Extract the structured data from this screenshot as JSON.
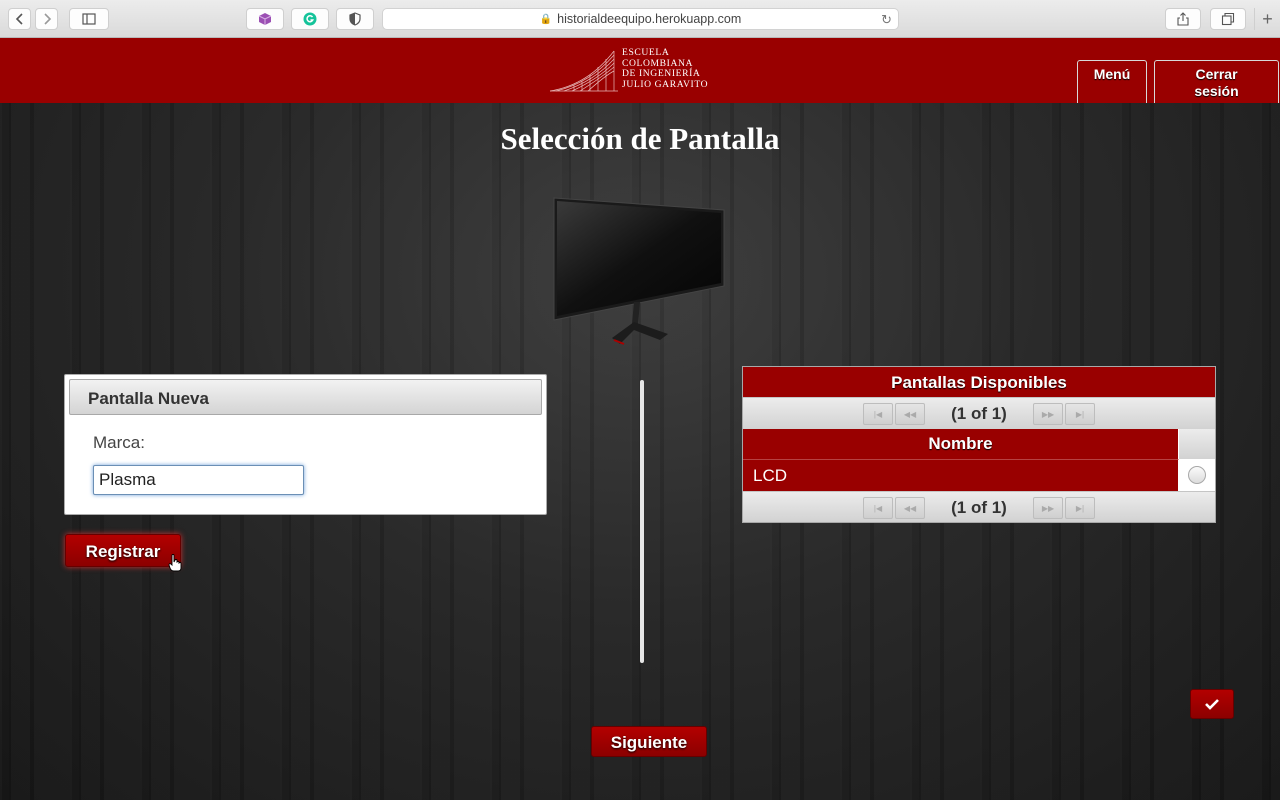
{
  "browser": {
    "url": "historialdeequipo.herokuapp.com"
  },
  "header": {
    "logo_lines": [
      "Escuela",
      "Colombiana",
      "de Ingeniería",
      "Julio Garavito"
    ],
    "menu_label": "Menú",
    "logout_label_line1": "Cerrar",
    "logout_label_line2": "sesión"
  },
  "page": {
    "title": "Selección de Pantalla"
  },
  "form": {
    "panel_title": "Pantalla Nueva",
    "marca_label": "Marca:",
    "marca_value": "Plasma",
    "register_button": "Registrar"
  },
  "table": {
    "title": "Pantallas Disponibles",
    "page_info_top": "(1 of 1)",
    "page_info_bottom": "(1 of 1)",
    "column_header": "Nombre",
    "rows": [
      {
        "nombre": "LCD"
      }
    ]
  },
  "next_button": "Siguiente",
  "colors": {
    "brand_red": "#990000",
    "background": "#1d1d1d"
  }
}
